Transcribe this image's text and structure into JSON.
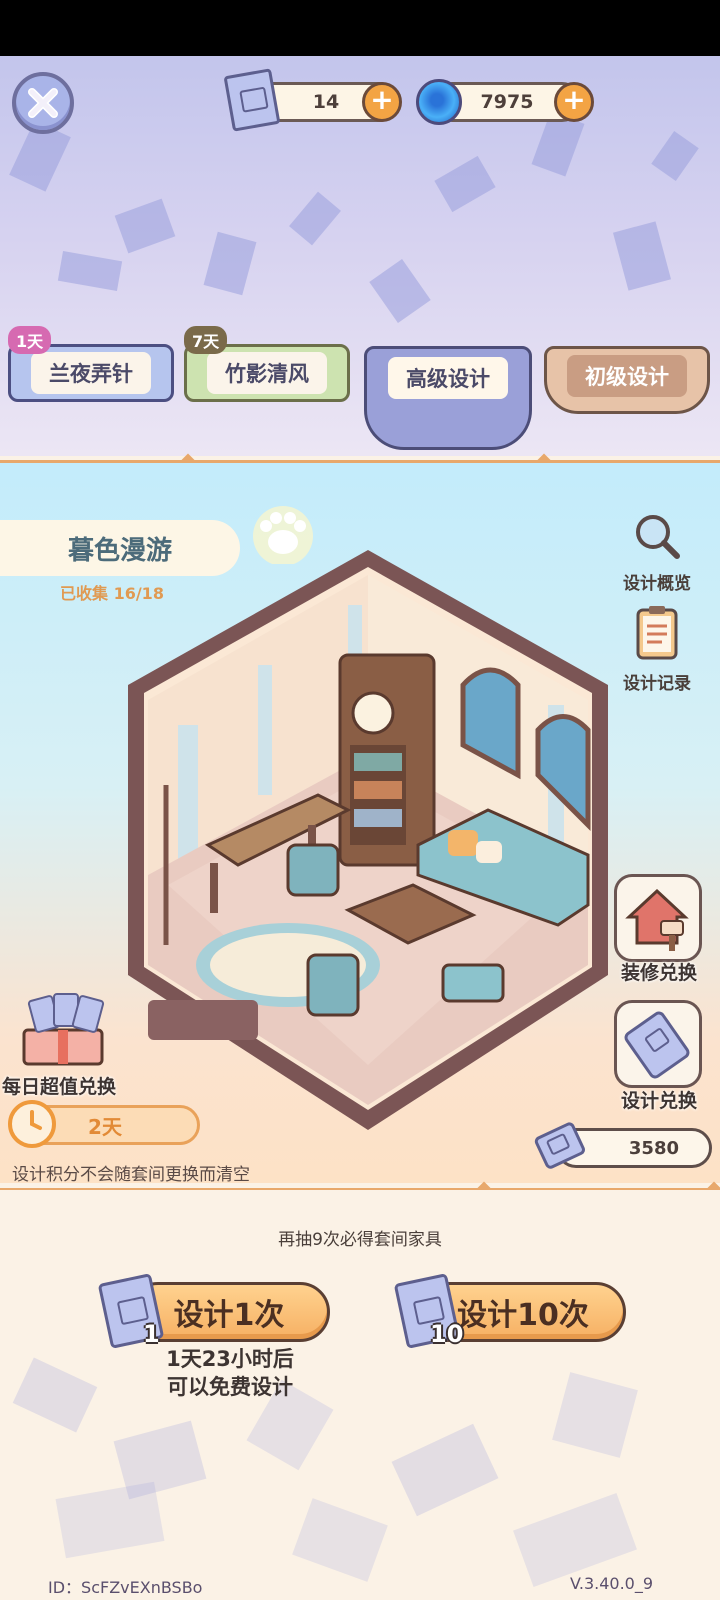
{
  "currency": {
    "tickets": "14",
    "gems": "7975"
  },
  "tabs": [
    {
      "label": "兰夜弄针",
      "badge": "1天"
    },
    {
      "label": "竹影清风",
      "badge": "7天"
    },
    {
      "label": "高级设计",
      "badge": ""
    },
    {
      "label": "初级设计",
      "badge": ""
    }
  ],
  "suite": {
    "title": "暮色漫游",
    "collected": "已收集 16/18"
  },
  "side": {
    "overview": "设计概览",
    "records": "设计记录",
    "renovate_exchange": "装修兑换",
    "design_exchange": "设计兑换"
  },
  "daily": {
    "label": "每日超值兑换",
    "timer": "2天"
  },
  "note": "设计积分不会随套间更换而清空",
  "points": "3580",
  "guarantee": "再抽9次必得套间家具",
  "draw": {
    "single_label": "设计1次",
    "single_cost": "1",
    "ten_label": "设计10次",
    "ten_cost": "10",
    "free_line1": "1天23小时后",
    "free_line2": "可以免费设计"
  },
  "footer": {
    "id": "ID：ScFZvEXnBSBo",
    "version": "V.3.40.0_9"
  },
  "colors": {
    "accent_orange": "#f3a444",
    "tab_active": "#9aa0d8",
    "divider": "#e8a86b"
  }
}
